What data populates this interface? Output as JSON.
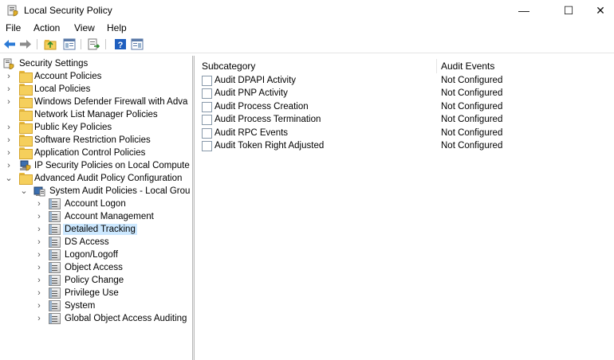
{
  "window": {
    "title": "Local Security Policy",
    "minimize_glyph": "—",
    "maximize_glyph": "☐",
    "close_glyph": "✕"
  },
  "menu": [
    "File",
    "Action",
    "View",
    "Help"
  ],
  "toolbar": {
    "buttons": [
      "back-arrow-icon",
      "forward-arrow-icon",
      "up-folder-icon",
      "show-hide-tree-icon",
      "export-list-icon",
      "help-icon",
      "properties-icon"
    ]
  },
  "tree": {
    "items": [
      {
        "label": "Security Settings",
        "icon": "security-settings-icon",
        "expander": "",
        "level": 0
      },
      {
        "label": "Account Policies",
        "icon": "folder-lock-icon",
        "expander": "›",
        "level": 1
      },
      {
        "label": "Local Policies",
        "icon": "folder-lock-icon",
        "expander": "›",
        "level": 1
      },
      {
        "label": "Windows Defender Firewall with Adva",
        "icon": "folder-icon",
        "expander": "›",
        "level": 1
      },
      {
        "label": "Network List Manager Policies",
        "icon": "folder-icon",
        "expander": "",
        "level": 1
      },
      {
        "label": "Public Key Policies",
        "icon": "folder-icon",
        "expander": "›",
        "level": 1
      },
      {
        "label": "Software Restriction Policies",
        "icon": "folder-icon",
        "expander": "›",
        "level": 1
      },
      {
        "label": "Application Control Policies",
        "icon": "folder-icon",
        "expander": "›",
        "level": 1
      },
      {
        "label": "IP Security Policies on Local Compute",
        "icon": "ip-security-icon",
        "expander": "›",
        "level": 1
      },
      {
        "label": "Advanced Audit Policy Configuration",
        "icon": "folder-icon",
        "expander": "⌄",
        "level": 1
      },
      {
        "label": "System Audit Policies - Local Grou",
        "icon": "audit-policies-icon",
        "expander": "⌄",
        "level": 2
      },
      {
        "label": "Account Logon",
        "icon": "policy-object-icon",
        "expander": "›",
        "level": 3
      },
      {
        "label": "Account Management",
        "icon": "policy-object-icon",
        "expander": "›",
        "level": 3
      },
      {
        "label": "Detailed Tracking",
        "icon": "policy-object-icon",
        "expander": "›",
        "level": 3,
        "selected": true
      },
      {
        "label": "DS Access",
        "icon": "policy-object-icon",
        "expander": "›",
        "level": 3
      },
      {
        "label": "Logon/Logoff",
        "icon": "policy-object-icon",
        "expander": "›",
        "level": 3
      },
      {
        "label": "Object Access",
        "icon": "policy-object-icon",
        "expander": "›",
        "level": 3
      },
      {
        "label": "Policy Change",
        "icon": "policy-object-icon",
        "expander": "›",
        "level": 3
      },
      {
        "label": "Privilege Use",
        "icon": "policy-object-icon",
        "expander": "›",
        "level": 3
      },
      {
        "label": "System",
        "icon": "policy-object-icon",
        "expander": "›",
        "level": 3
      },
      {
        "label": "Global Object Access Auditing",
        "icon": "policy-object-icon",
        "expander": "›",
        "level": 3
      }
    ]
  },
  "list": {
    "columns": [
      "Subcategory",
      "Audit Events"
    ],
    "rows": [
      {
        "subcategory": "Audit DPAPI Activity",
        "audit_events": "Not Configured"
      },
      {
        "subcategory": "Audit PNP Activity",
        "audit_events": "Not Configured"
      },
      {
        "subcategory": "Audit Process Creation",
        "audit_events": "Not Configured"
      },
      {
        "subcategory": "Audit Process Termination",
        "audit_events": "Not Configured"
      },
      {
        "subcategory": "Audit RPC Events",
        "audit_events": "Not Configured"
      },
      {
        "subcategory": "Audit Token Right Adjusted",
        "audit_events": "Not Configured"
      }
    ]
  },
  "colors": {
    "selection": "#cce8ff",
    "folder": "#f5cf5c",
    "nav_arrow": "#2b7ad6"
  }
}
